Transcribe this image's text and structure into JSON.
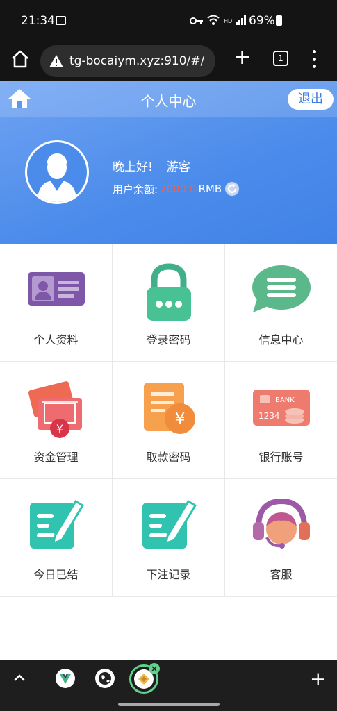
{
  "status_bar": {
    "time": "21:34",
    "hd": "HD",
    "battery": "69%"
  },
  "browser": {
    "url": "tg-bocaiym.xyz:910/#/",
    "tab_count": "1"
  },
  "header": {
    "title": "个人中心",
    "logout": "退出",
    "greeting": "晚上好!",
    "username": "游客",
    "balance_label": "用户余额:",
    "balance_value": "2000.0",
    "balance_unit": "RMB"
  },
  "menu": [
    {
      "label": "个人资料"
    },
    {
      "label": "登录密码"
    },
    {
      "label": "信息中心"
    },
    {
      "label": "资金管理"
    },
    {
      "label": "取款密码"
    },
    {
      "label": "银行账号"
    },
    {
      "label": "今日已结"
    },
    {
      "label": "下注记录"
    },
    {
      "label": "客服"
    }
  ],
  "card_texts": {
    "bank": "BANK",
    "number": "1234",
    "yen": "¥"
  },
  "colors": {
    "header": "#4b8bea",
    "balance": "#f0634a",
    "accent_teal": "#2fbfae"
  }
}
